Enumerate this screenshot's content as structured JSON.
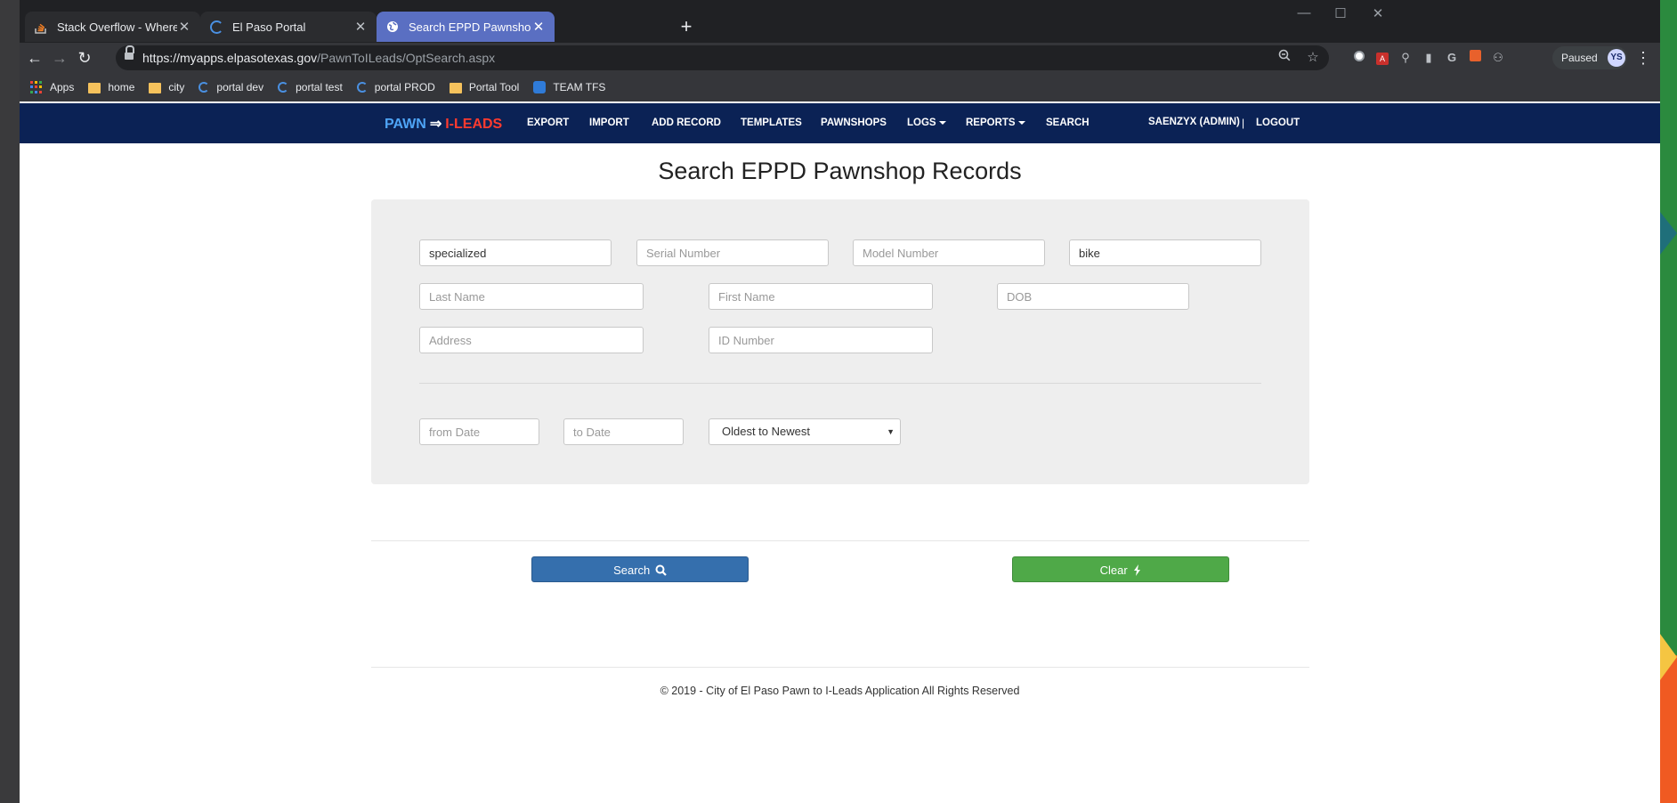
{
  "browser": {
    "tabs": [
      {
        "label": "Stack Overflow - Where Developers",
        "icon": "stackoverflow-icon",
        "active": false
      },
      {
        "label": "El Paso Portal",
        "icon": "edge-e-icon",
        "active": false
      },
      {
        "label": "Search EPPD Pawnshop Records",
        "icon": "globe-icon",
        "active": true
      }
    ],
    "url_domain": "https://myapps.elpasotexas.gov",
    "url_path": "/PawnToILeads/OptSearch.aspx",
    "profile_status": "Paused",
    "profile_initials": "YS",
    "bookmarks": [
      {
        "label": "Apps",
        "icon": "apps-grid-icon"
      },
      {
        "label": "home",
        "icon": "folder-icon"
      },
      {
        "label": "city",
        "icon": "folder-icon"
      },
      {
        "label": "portal dev",
        "icon": "edge-e-icon"
      },
      {
        "label": "portal test",
        "icon": "edge-e-icon"
      },
      {
        "label": "portal PROD",
        "icon": "edge-e-icon"
      },
      {
        "label": "Portal Tool",
        "icon": "folder-icon"
      },
      {
        "label": "TEAM TFS",
        "icon": "tfs-icon"
      }
    ]
  },
  "navbar": {
    "brand_left": "PAWN",
    "brand_arrow": "⇒",
    "brand_right": "I-LEADS",
    "links": [
      "EXPORT",
      "IMPORT",
      "ADD RECORD",
      "TEMPLATES",
      "PAWNSHOPS",
      "LOGS",
      "REPORTS",
      "SEARCH"
    ],
    "user": "SAENZYX (ADMIN)",
    "separator": "|",
    "logout": "LOGOUT"
  },
  "page": {
    "title": "Search EPPD Pawnshop Records"
  },
  "form": {
    "row1": [
      {
        "value": "specialized",
        "placeholder": ""
      },
      {
        "value": "",
        "placeholder": "Serial Number"
      },
      {
        "value": "",
        "placeholder": "Model Number"
      },
      {
        "value": "bike",
        "placeholder": ""
      }
    ],
    "row2": [
      {
        "value": "",
        "placeholder": "Last Name"
      },
      {
        "value": "",
        "placeholder": "First Name"
      },
      {
        "value": "",
        "placeholder": "DOB"
      }
    ],
    "row3": [
      {
        "value": "",
        "placeholder": "Address"
      },
      {
        "value": "",
        "placeholder": "ID Number"
      }
    ],
    "from_date_placeholder": "from Date",
    "to_date_placeholder": "to Date",
    "sort_selected": "Oldest to Newest"
  },
  "buttons": {
    "search": "Search",
    "clear": "Clear"
  },
  "footer": "© 2019 - City of El Paso Pawn to I-Leads Application All Rights Reserved",
  "colors": {
    "navbar_bg": "#0b2255",
    "brand_blue": "#4ea4f6",
    "brand_red": "#ff3b2f",
    "search_button": "#356fad",
    "clear_button": "#4fa948",
    "panel_bg": "#eeeeee",
    "active_tab": "#5a6fc2"
  }
}
